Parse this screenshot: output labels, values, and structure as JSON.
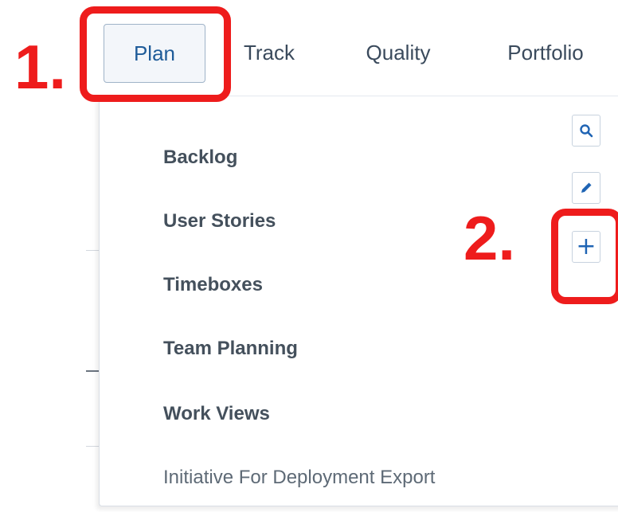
{
  "tabs": [
    {
      "label": "Plan",
      "active": true
    },
    {
      "label": "Track"
    },
    {
      "label": "Quality"
    },
    {
      "label": "Portfolio"
    }
  ],
  "plan_menu": {
    "items": [
      "Backlog",
      "User Stories",
      "Timeboxes",
      "Team Planning",
      "Work Views"
    ],
    "extra_item": "Initiative For Deployment Export"
  },
  "toolbar": {
    "search_icon": "search-icon",
    "edit_icon": "pencil-icon",
    "add_icon": "plus-icon"
  },
  "callouts": [
    "1.",
    "2."
  ],
  "colors": {
    "accent": "#1f64b4",
    "callout": "#ee1c1c",
    "tab_text": "#3a4a5c",
    "menu_text": "#44505c"
  }
}
